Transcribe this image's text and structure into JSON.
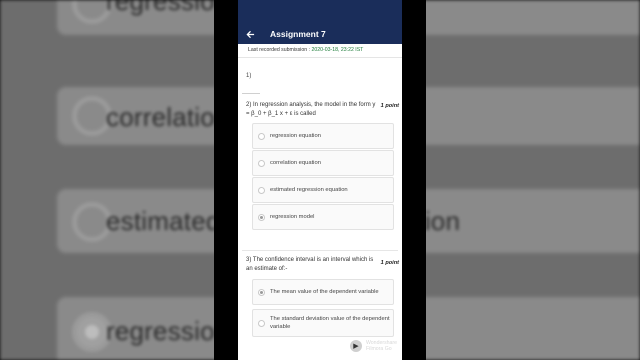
{
  "background": {
    "options": [
      {
        "text": "regression equation",
        "selected": false
      },
      {
        "text": "correlation equation",
        "selected": false
      },
      {
        "text": "estimated regression equation",
        "selected": false
      },
      {
        "text": "regression model",
        "selected": true
      }
    ]
  },
  "appbar": {
    "title": "Assignment 7",
    "back_icon": "arrow-left-icon"
  },
  "submission": {
    "label": "Last recorded submission : ",
    "value": "2020-03-18, 23:22 IST"
  },
  "questions": [
    {
      "number": "1)"
    },
    {
      "number": "2)",
      "text": "In regression analysis, the model in the form y = β_0 + β_1 x + ε is called",
      "points": "1 point",
      "options": [
        {
          "text": "regression equation",
          "selected": false
        },
        {
          "text": "correlation equation",
          "selected": false
        },
        {
          "text": "estimated regression equation",
          "selected": false
        },
        {
          "text": "regression model",
          "selected": true
        }
      ]
    },
    {
      "number": "3)",
      "text": "The confidence interval is an interval which is an estimate of:-",
      "points": "1 point",
      "options": [
        {
          "text": "The mean value of the dependent variable",
          "selected": true
        },
        {
          "text": "The standard deviation value of the dependent variable",
          "selected": false
        }
      ]
    }
  ],
  "watermark": {
    "line1": "Wondershare",
    "line2": "Filmora Go"
  }
}
